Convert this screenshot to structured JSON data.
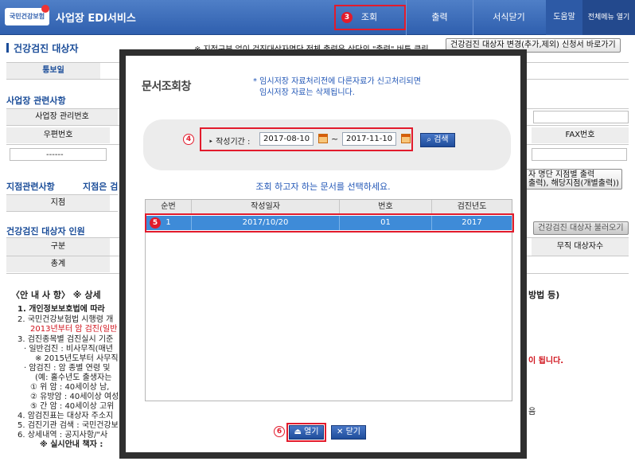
{
  "header": {
    "logo_text": "국민건강보험",
    "service_title": "사업장 EDI서비스",
    "nav": {
      "inquiry": "조회",
      "print": "출력",
      "forms": "서식닫기",
      "help": "도움말",
      "all_menu": "전체메뉴 열기"
    }
  },
  "page": {
    "title": "건강검진 대상자",
    "note": "※ 지점구분 없이 검진대상자명단 전체 출력은 상단의 \"출력\" 버튼 클릭",
    "change_button": "건강검진 대상자 변경(추가,제외) 신청서 바로가기",
    "notify_date_label": "통보일",
    "workplace_section": "사업장 관련사항",
    "workplace_id_label": "사업장 관리번호",
    "zip_label": "우편번호",
    "zip_value": "------",
    "fax_label": "FAX번호",
    "branch_section": "지점관련사항",
    "branch_section_note": "지점은 검",
    "branch_label": "지점",
    "branch_print_button": "자 명단 지점별 출력\n출력), 해당지점(개별출력))",
    "target_section": "건강검진 대상자 인원",
    "target_load_button": "건강검진 대상자 불러오기",
    "category_label": "구분",
    "total_label": "총계",
    "office_target_label": "무직 대상자수",
    "notice_title": "〈안 내 사 항〉 ※ 상세",
    "notice_tail": "방법 등)",
    "notice_lines": [
      "1. 개인정보보호법에 따라",
      "2. 국민건강보험법 시행령 개",
      "2013년부터 암 검진(일반",
      "3. 검진종목별 검진실시 기준",
      "· 일반검진 : 비사무직(매년",
      "※ 2015년도부터 사무직",
      "· 암검진 : 암 종별 연령 및",
      "(예: 홀수년도 출생자는",
      "① 위   암 : 40세이상 남,",
      "② 유방암 : 40세이상 여성",
      "⑤ 간   암 : 40세이상 고위",
      "4. 암검진표는 대상자 주소지",
      "5. 검진기관 검색 : 국민건강보",
      "6. 상세내역 :  공지사항/\"사",
      "※ 실시안내 책자 :"
    ],
    "notice_red_right": "이 됩니다.",
    "notice_right_tail": "음"
  },
  "modal": {
    "title": "문서조회창",
    "note_lines": [
      "* 임시저장 자료처리전에 다른자료가 신고처리되면",
      "임시저장 자료는 삭제됩니다."
    ],
    "period_label": "작성기간 :",
    "date_from": "2017-08-10",
    "tilde": "~",
    "date_to": "2017-11-10",
    "search_button": "검색",
    "select_prompt": "조회 하고자 하는 문서를 선택하세요.",
    "columns": [
      "순번",
      "작성일자",
      "번호",
      "검진년도"
    ],
    "rows": [
      {
        "seq": "1",
        "date": "2017/10/20",
        "num": "01",
        "year": "2017"
      }
    ],
    "open_button": "열기",
    "close_button": "닫기"
  },
  "annotations": {
    "step3": "3",
    "step4": "4",
    "step5": "5",
    "step6": "6"
  },
  "colors": {
    "highlight": "#e21b2c",
    "header": "#2f5fae",
    "selected_row": "#3e8bd8",
    "note_blue": "#2156b6"
  }
}
